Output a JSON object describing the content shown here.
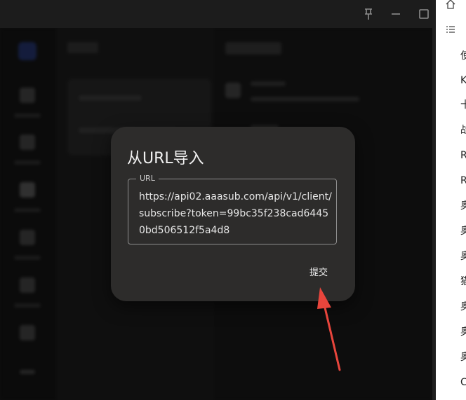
{
  "dialog": {
    "title": "从URL导入",
    "field_label": "URL",
    "field_value": "https://api02.aaasub.com/api/v1/client/subscribe?token=99bc35f238cad64450bd506512f5a4d8",
    "submit_label": "提交"
  },
  "titlebar": {
    "pin_icon": "pin-icon",
    "minimize_icon": "minimize-icon",
    "maximize_icon": "maximize-icon"
  },
  "side_panel": {
    "home_icon": "home-icon",
    "list_icon": "list-icon",
    "items": [
      "使",
      "K",
      "十",
      "战",
      "R",
      "R",
      "奥",
      "奥",
      "奥",
      "猫",
      "奥",
      "奥",
      "奥",
      "C"
    ]
  },
  "colors": {
    "dialog_bg": "#2d2c2b",
    "arrow": "#e8453c"
  }
}
